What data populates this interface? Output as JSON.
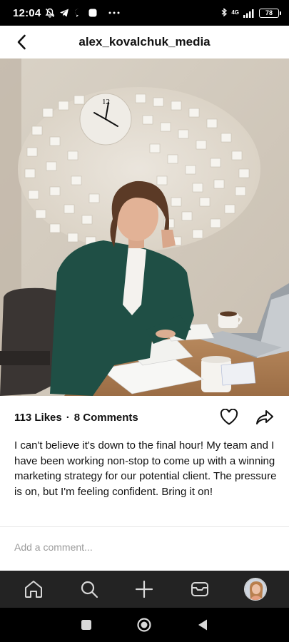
{
  "status_bar": {
    "time": "12:04",
    "network_label": "4G",
    "battery_level": "78"
  },
  "header": {
    "username": "alex_kovalchuk_media"
  },
  "post": {
    "likes": "113 Likes",
    "separator": "·",
    "comments": "8 Comments",
    "caption": "I can't believe it's down to the final hour! My team and I have been working non-stop to come up with a winning marketing strategy for our potential client. The pressure is on, but I'm feeling confident. Bring it on!"
  },
  "comment_box": {
    "placeholder": "Add a comment..."
  },
  "icons": {
    "back": "chevron-left-icon",
    "like": "heart-icon",
    "share": "share-arrow-icon",
    "nav": [
      "home-icon",
      "search-icon",
      "plus-icon",
      "inbox-icon",
      "avatar"
    ],
    "system": [
      "square-icon",
      "circle-icon",
      "triangle-back-icon"
    ]
  },
  "colors": {
    "status_bar_bg": "#000000",
    "bottom_nav_bg": "#232323",
    "text": "#111111",
    "placeholder": "#9b9b9b"
  }
}
